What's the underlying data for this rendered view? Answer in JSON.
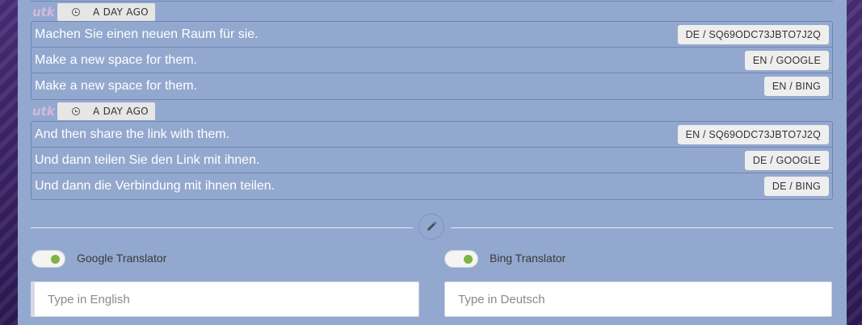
{
  "messages": [
    {
      "user": "utk",
      "time": "A DAY AGO",
      "lines": [
        {
          "text": "Machen Sie einen neuen Raum für sie.",
          "badge": "DE / SQ69ODC73JBTO7J2Q"
        },
        {
          "text": "Make a new space for them.",
          "badge": "EN / GOOGLE"
        },
        {
          "text": "Make a new space for them.",
          "badge": "EN / BING"
        }
      ]
    },
    {
      "user": "utk",
      "time": "A DAY AGO",
      "lines": [
        {
          "text": "And then share the link with them.",
          "badge": "EN / SQ69ODC73JBTO7J2Q"
        },
        {
          "text": "Und dann teilen Sie den Link mit ihnen.",
          "badge": "DE / GOOGLE"
        },
        {
          "text": "Und dann die Verbindung mit ihnen teilen.",
          "badge": "DE / BING"
        }
      ]
    }
  ],
  "translators": {
    "google": {
      "label": "Google Translator",
      "enabled": true
    },
    "bing": {
      "label": "Bing Translator",
      "enabled": true
    }
  },
  "inputs": {
    "english_placeholder": "Type in English",
    "deutsch_placeholder": "Type in Deutsch"
  },
  "icons": {
    "edit": "pencil-icon",
    "time": "clock-icon"
  },
  "colors": {
    "panel": "#93a8ce",
    "toggle_on": "#7cb342",
    "user_name": "#d6b8dc"
  }
}
